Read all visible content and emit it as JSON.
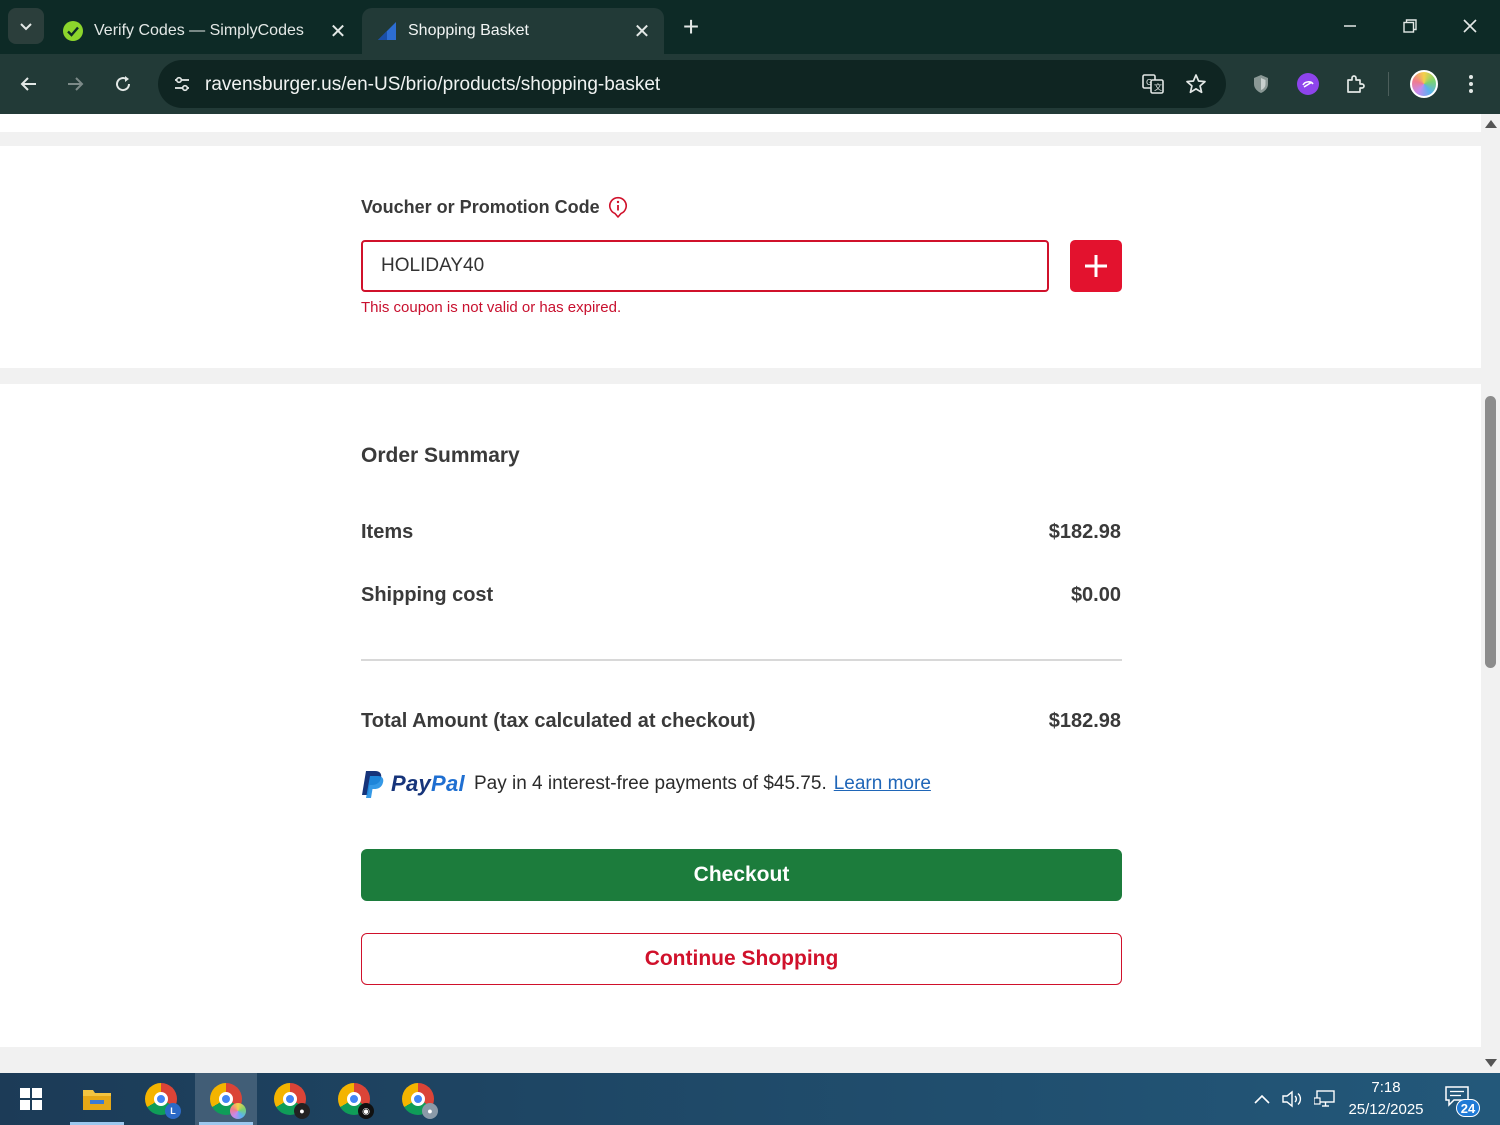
{
  "browser": {
    "tabs": [
      {
        "title": "Verify Codes — SimplyCodes",
        "active": false,
        "favicon": "simplycodes-icon"
      },
      {
        "title": "Shopping Basket",
        "active": true,
        "favicon": "ravensburger-icon"
      }
    ],
    "url": "ravensburger.us/en-US/brio/products/shopping-basket",
    "colors": {
      "frame": "#0d2a26",
      "toolbar": "#223a37"
    }
  },
  "voucher": {
    "label": "Voucher or Promotion Code",
    "value": "HOLIDAY40",
    "error": "This coupon is not valid or has expired."
  },
  "summary": {
    "title": "Order Summary",
    "items_label": "Items",
    "items_value": "$182.98",
    "shipping_label": "Shipping cost",
    "shipping_value": "$0.00",
    "total_label": "Total Amount (tax calculated at checkout)",
    "total_value": "$182.98"
  },
  "paypal": {
    "brand_pay": "Pay",
    "brand_pal": "Pal",
    "message": "Pay in 4 interest-free payments of $45.75.",
    "link": "Learn more"
  },
  "actions": {
    "checkout": "Checkout",
    "continue": "Continue Shopping"
  },
  "colors": {
    "accent_red": "#d0112b",
    "checkout_green": "#1c7c3c",
    "paypal_blue": "#1f6fd1"
  },
  "taskbar": {
    "time": "7:18",
    "date": "25/12/2025",
    "notifications": "24"
  }
}
